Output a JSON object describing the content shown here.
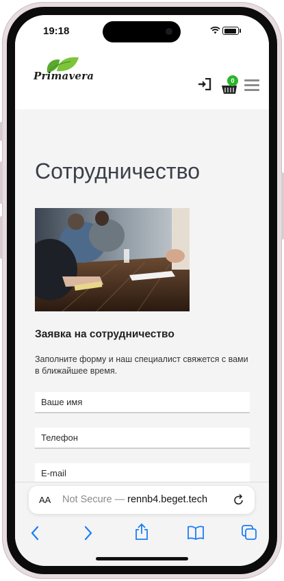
{
  "status_bar": {
    "time": "19:18"
  },
  "site": {
    "logo_text": "Primavera",
    "cart_count": "0"
  },
  "page": {
    "title": "Сотрудничество",
    "form_title": "Заявка на сотрудничество",
    "form_description": "Заполните форму и наш специалист свяжется с вами в ближайшее время.",
    "fields": {
      "name_placeholder": "Ваше имя",
      "phone_placeholder": "Телефон",
      "email_placeholder": "E-mail"
    }
  },
  "browser": {
    "text_size_label": "AA",
    "security_label": "Not Secure —",
    "domain": "rennb4.beget.tech"
  },
  "colors": {
    "accent_green": "#2db52d",
    "title_text": "#3b3f4a",
    "ios_blue": "#1a7cf5"
  },
  "icons": [
    "login-icon",
    "cart-icon",
    "menu-icon",
    "reload-icon",
    "back-icon",
    "forward-icon",
    "share-icon",
    "bookmarks-icon",
    "tabs-icon"
  ]
}
